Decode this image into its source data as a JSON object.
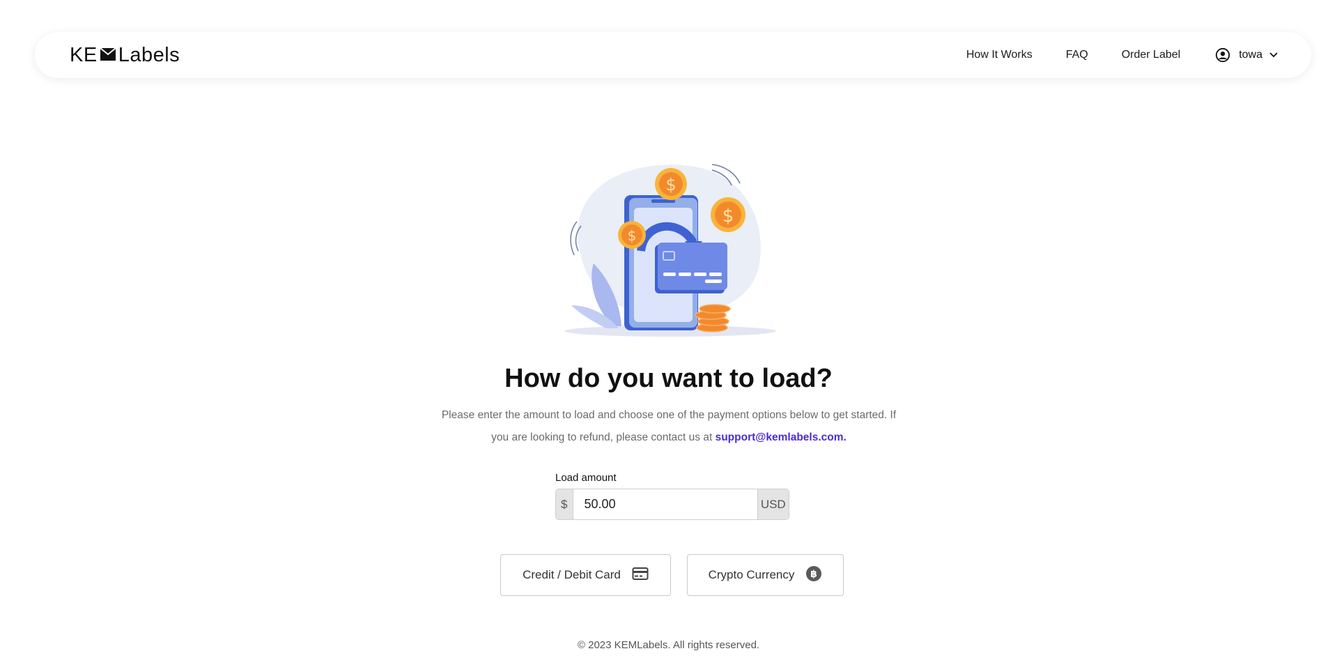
{
  "header": {
    "logo_left": "KE",
    "logo_right": "Labels",
    "nav": [
      "How It Works",
      "FAQ",
      "Order Label"
    ],
    "user": "towa"
  },
  "main": {
    "title": "How do you want to load?",
    "description_text": "Please enter the amount to load and choose one of the payment options below to get started. If you are looking to refund, please contact us at ",
    "support_email": "support@kemlabels.com.",
    "load_label": "Load amount",
    "currency_symbol": "$",
    "amount_value": "50.00",
    "currency": "USD",
    "payment_options": [
      "Credit / Debit Card",
      "Crypto Currency"
    ]
  },
  "footer": {
    "copyright": "© 2023 KEMLabels. All rights reserved."
  },
  "colors": {
    "accent": "#4b2bd6",
    "border": "#c9c9c9",
    "addon_bg": "#e4e4e4"
  },
  "icons": {
    "logo": "envelope-icon",
    "user": "user-circle-icon",
    "dropdown": "chevron-down-icon",
    "card": "credit-card-icon",
    "crypto": "bitcoin-icon"
  }
}
